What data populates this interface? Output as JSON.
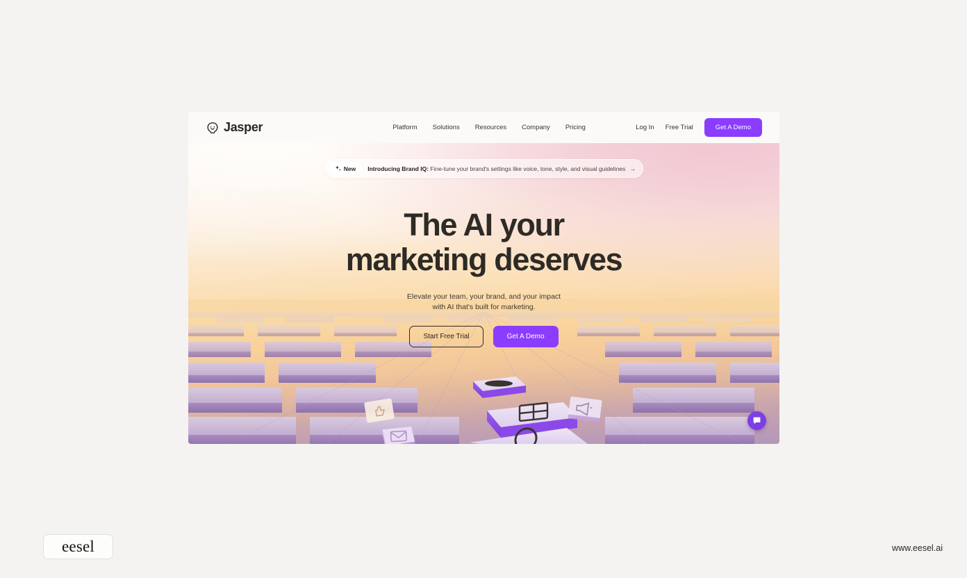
{
  "page": {
    "background_color": "#f4f3f1",
    "accent_color": "#8b3dff"
  },
  "site": {
    "brand": {
      "name": "Jasper",
      "logo_icon": "jasper-smiley-blob-icon"
    },
    "nav": [
      {
        "label": "Platform"
      },
      {
        "label": "Solutions"
      },
      {
        "label": "Resources"
      },
      {
        "label": "Company"
      },
      {
        "label": "Pricing"
      }
    ],
    "actions": {
      "login_label": "Log In",
      "free_trial_label": "Free Trial",
      "demo_label": "Get A Demo"
    }
  },
  "announcement": {
    "sparkle_icon": "sparkle-icon",
    "badge_label": "New",
    "headline": "Introducing Brand IQ:",
    "body": "Fine-tune your brand's settings like voice, tone, style, and visual guidelines",
    "arrow_icon": "arrow-right-icon"
  },
  "hero": {
    "title_line1": "The AI your",
    "title_line2": "marketing deserves",
    "subtitle_line1": "Elevate your team, your brand, and your impact",
    "subtitle_line2": "with AI that's built for marketing.",
    "primary_cta": "Start Free Trial",
    "secondary_cta": "Get A Demo",
    "floating_cards": [
      {
        "icon": "thumbs-up-icon"
      },
      {
        "icon": "envelope-icon"
      },
      {
        "icon": "megaphone-icon"
      },
      {
        "icon": "grid-table-icon"
      },
      {
        "icon": "magnifier-icon"
      }
    ]
  },
  "chat_widget": {
    "icon": "chat-bubble-icon",
    "color": "#7b3fe4"
  },
  "watermark": {
    "logo_text": "eesel",
    "url": "www.eesel.ai"
  }
}
